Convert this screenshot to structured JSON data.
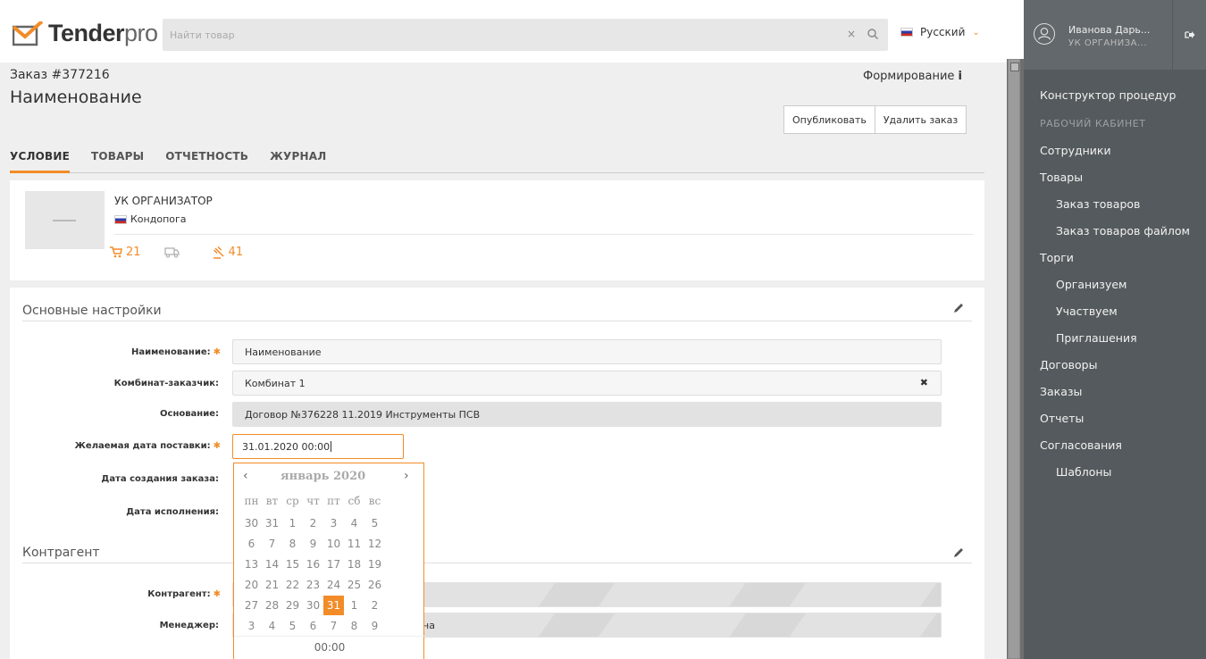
{
  "header": {
    "logo_text_main": "Tender",
    "logo_text_pro": "pro",
    "search_placeholder": "Найти товар",
    "search_clear": "×",
    "language": "Русский"
  },
  "order": {
    "number_label": "Заказ #377216",
    "title": "Наименование",
    "status": "Формирование",
    "status_icon": "i",
    "publish_label": "Опубликовать",
    "delete_label": "Удалить заказ"
  },
  "tabs": [
    {
      "label": "УСЛОВИЕ",
      "active": true
    },
    {
      "label": "ТОВАРЫ"
    },
    {
      "label": "ОТЧЕТНОСТЬ"
    },
    {
      "label": "ЖУРНАЛ"
    }
  ],
  "organization": {
    "name": "УК ОРГАНИЗАТОР",
    "city": "Кондопога",
    "cart_count": "21",
    "auction_count": "41"
  },
  "main_settings": {
    "title": "Основные настройки",
    "name_label": "Наименование:",
    "name_value": "Наименование",
    "customer_label": "Комбинат-заказчик:",
    "customer_value": "Комбинат 1",
    "basis_label": "Основание:",
    "basis_value": "Договор №376228 11.2019 Инструменты ПСВ",
    "delivery_label": "Желаемая дата поставки:",
    "delivery_value": "31.01.2020 00:00",
    "created_label": "Дата создания заказа:",
    "executed_label": "Дата исполнения:"
  },
  "counterparty": {
    "title": "Контрагент",
    "party_label": "Контрагент:",
    "manager_label": "Менеджер:",
    "manager_value_tail": "на"
  },
  "datepicker": {
    "prev": "‹",
    "next": "›",
    "title": "январь 2020",
    "weekdays": [
      "пн",
      "вт",
      "ср",
      "чт",
      "пт",
      "сб",
      "вс"
    ],
    "weeks": [
      [
        "30",
        "31",
        "1",
        "2",
        "3",
        "4",
        "5"
      ],
      [
        "6",
        "7",
        "8",
        "9",
        "10",
        "11",
        "12"
      ],
      [
        "13",
        "14",
        "15",
        "16",
        "17",
        "18",
        "19"
      ],
      [
        "20",
        "21",
        "22",
        "23",
        "24",
        "25",
        "26"
      ],
      [
        "27",
        "28",
        "29",
        "30",
        "31",
        "1",
        "2"
      ],
      [
        "3",
        "4",
        "5",
        "6",
        "7",
        "8",
        "9"
      ]
    ],
    "selected": "31",
    "time": "00:00"
  },
  "user": {
    "name": "Иванова Дарь...",
    "org": "УК ОРГАНИЗА..."
  },
  "sidebar": {
    "items": [
      {
        "label": "Конструктор процедур",
        "type": "item"
      },
      {
        "label": "РАБОЧИЙ КАБИНЕТ",
        "type": "head"
      },
      {
        "label": "Сотрудники",
        "type": "item"
      },
      {
        "label": "Товары",
        "type": "item"
      },
      {
        "label": "Заказ товаров",
        "type": "sub"
      },
      {
        "label": "Заказ товаров файлом",
        "type": "sub"
      },
      {
        "label": "Торги",
        "type": "item"
      },
      {
        "label": "Организуем",
        "type": "sub"
      },
      {
        "label": "Участвуем",
        "type": "sub"
      },
      {
        "label": "Приглашения",
        "type": "sub"
      },
      {
        "label": "Договоры",
        "type": "item"
      },
      {
        "label": "Заказы",
        "type": "item"
      },
      {
        "label": "Отчеты",
        "type": "item"
      },
      {
        "label": "Согласования",
        "type": "item"
      },
      {
        "label": "Шаблоны",
        "type": "sub"
      }
    ]
  },
  "colors": {
    "accent": "#f28c28",
    "sidebar_bg": "#545a5d",
    "page_bg": "#efefef"
  }
}
